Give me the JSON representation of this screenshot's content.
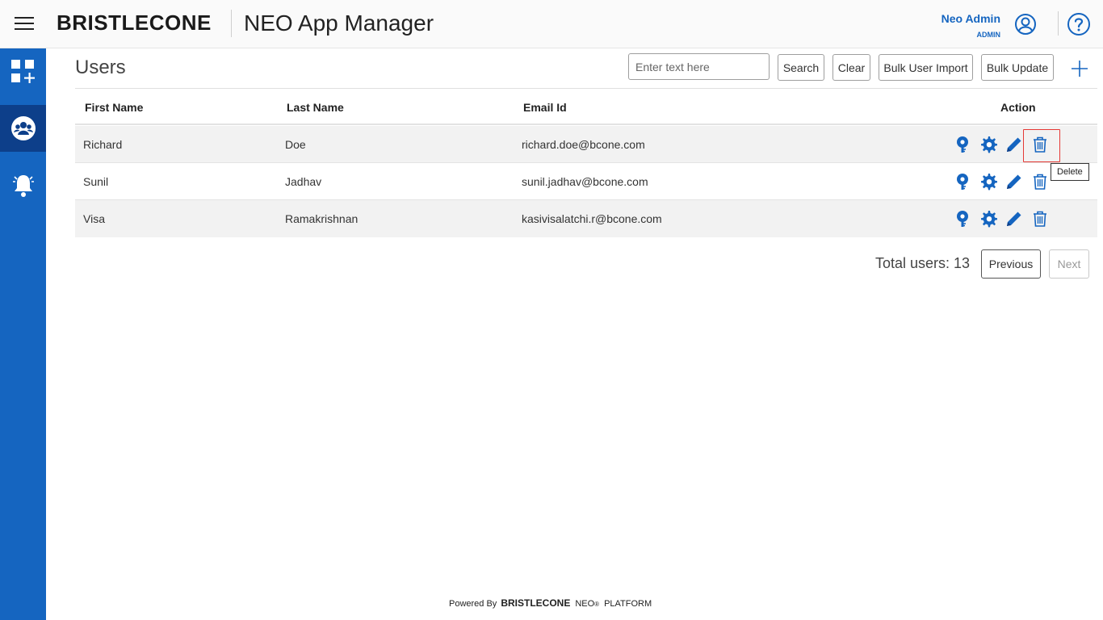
{
  "header": {
    "brand": "BRISTLECONE",
    "app_title": "NEO App Manager",
    "user_name": "Neo Admin",
    "user_role": "ADMIN"
  },
  "sidebar": {
    "items": [
      {
        "name": "dashboard-add",
        "icon": "grid-plus-icon",
        "active": false
      },
      {
        "name": "users",
        "icon": "users-icon",
        "active": true
      },
      {
        "name": "notifications",
        "icon": "bell-icon",
        "active": false
      }
    ]
  },
  "page": {
    "title": "Users",
    "search_placeholder": "Enter text here",
    "search_label": "Search",
    "clear_label": "Clear",
    "bulk_import_label": "Bulk User Import",
    "bulk_update_label": "Bulk Update"
  },
  "table": {
    "headers": [
      "First Name",
      "Last Name",
      "Email Id",
      "Action"
    ],
    "rows": [
      {
        "first": "Richard",
        "last": "Doe",
        "email": "richard.doe@bcone.com"
      },
      {
        "first": "Sunil",
        "last": "Jadhav",
        "email": "sunil.jadhav@bcone.com"
      },
      {
        "first": "Visa",
        "last": "Ramakrishnan",
        "email": "kasivisalatchi.r@bcone.com"
      }
    ]
  },
  "tooltip": "Delete",
  "pagination": {
    "total": "Total users: 13",
    "previous": "Previous",
    "next": "Next"
  },
  "footer": {
    "powered_by": "Powered By",
    "brand": "BRISTLECONE",
    "neo": "NEO",
    "reg": "®",
    "platform": "PLATFORM"
  },
  "colors": {
    "primary": "#1565c0",
    "sidebar_active": "#0d3f8a",
    "row_shade": "#f2f2f2",
    "highlight": "#e53935"
  }
}
